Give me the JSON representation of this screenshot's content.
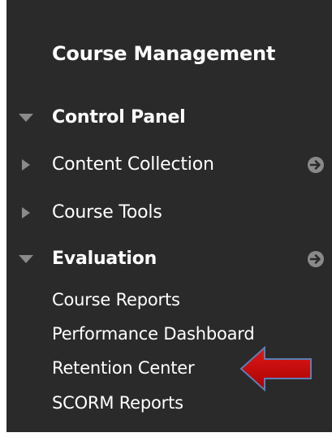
{
  "panel": {
    "title": "Course Management",
    "background": "#2a2a2a"
  },
  "control_panel": {
    "label": "Control Panel",
    "expanded": true,
    "items": [
      {
        "label": "Content Collection",
        "expanded": false,
        "has_go_icon": true
      },
      {
        "label": "Course Tools",
        "expanded": false,
        "has_go_icon": false
      },
      {
        "label": "Evaluation",
        "expanded": true,
        "has_go_icon": true
      }
    ]
  },
  "evaluation": {
    "links": [
      {
        "label": "Course Reports"
      },
      {
        "label": "Performance Dashboard"
      },
      {
        "label": "Retention Center"
      },
      {
        "label": "SCORM Reports"
      }
    ]
  },
  "icons": {
    "expanded": "triangle-down-icon",
    "collapsed": "triangle-right-icon",
    "go": "arrow-circle-right-icon",
    "pointer": "red-arrow-pointer-icon"
  },
  "colors": {
    "text": "#ffffff",
    "icon_gray": "#8a8a8a",
    "pointer_fill": "#c00000",
    "pointer_stroke": "#5b7fb4"
  }
}
